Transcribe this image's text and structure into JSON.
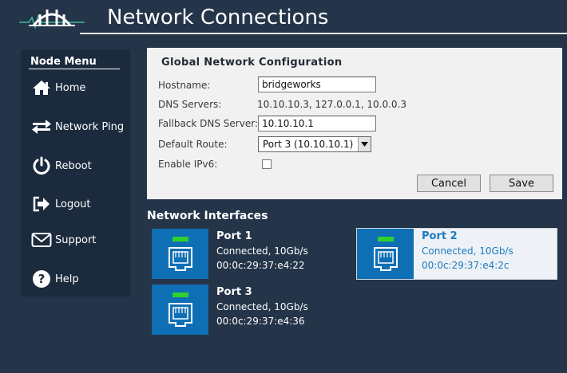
{
  "header": {
    "title": "Network Connections",
    "logo_icon": "bridge-logo-icon"
  },
  "sidebar": {
    "title": "Node Menu",
    "items": [
      {
        "label": "Home",
        "icon": "home-icon"
      },
      {
        "label": "Network Ping",
        "icon": "arrows-exchange-icon"
      },
      {
        "label": "Reboot",
        "icon": "power-icon"
      },
      {
        "label": "Logout",
        "icon": "logout-icon"
      },
      {
        "label": "Support",
        "icon": "envelope-icon"
      },
      {
        "label": "Help",
        "icon": "help-icon"
      }
    ]
  },
  "config": {
    "title": "Global Network Configuration",
    "hostname_label": "Hostname:",
    "hostname_value": "bridgeworks",
    "dns_label": "DNS Servers:",
    "dns_value": "10.10.10.3, 127.0.0.1, 10.0.0.3",
    "fallback_label": "Fallback DNS Server:",
    "fallback_value": "10.10.10.1",
    "route_label": "Default Route:",
    "route_value": "Port 3 (10.10.10.1)",
    "ipv6_label": "Enable IPv6:",
    "ipv6_checked": false,
    "cancel_label": "Cancel",
    "save_label": "Save"
  },
  "interfaces": {
    "title": "Network Interfaces",
    "ports": [
      {
        "name": "Port 1",
        "status": "Connected, 10Gb/s",
        "mac": "00:0c:29:37:e4:22",
        "selected": false
      },
      {
        "name": "Port 2",
        "status": "Connected, 10Gb/s",
        "mac": "00:0c:29:37:e4:2c",
        "selected": true
      },
      {
        "name": "Port 3",
        "status": "Connected, 10Gb/s",
        "mac": "00:0c:29:37:e4:36",
        "selected": false
      }
    ]
  },
  "colors": {
    "background": "#243449",
    "sidebar": "#1b2a3d",
    "port_tile": "#0f6fb4",
    "link_led": "#2fd12f",
    "selected_text": "#1a7cc0"
  }
}
